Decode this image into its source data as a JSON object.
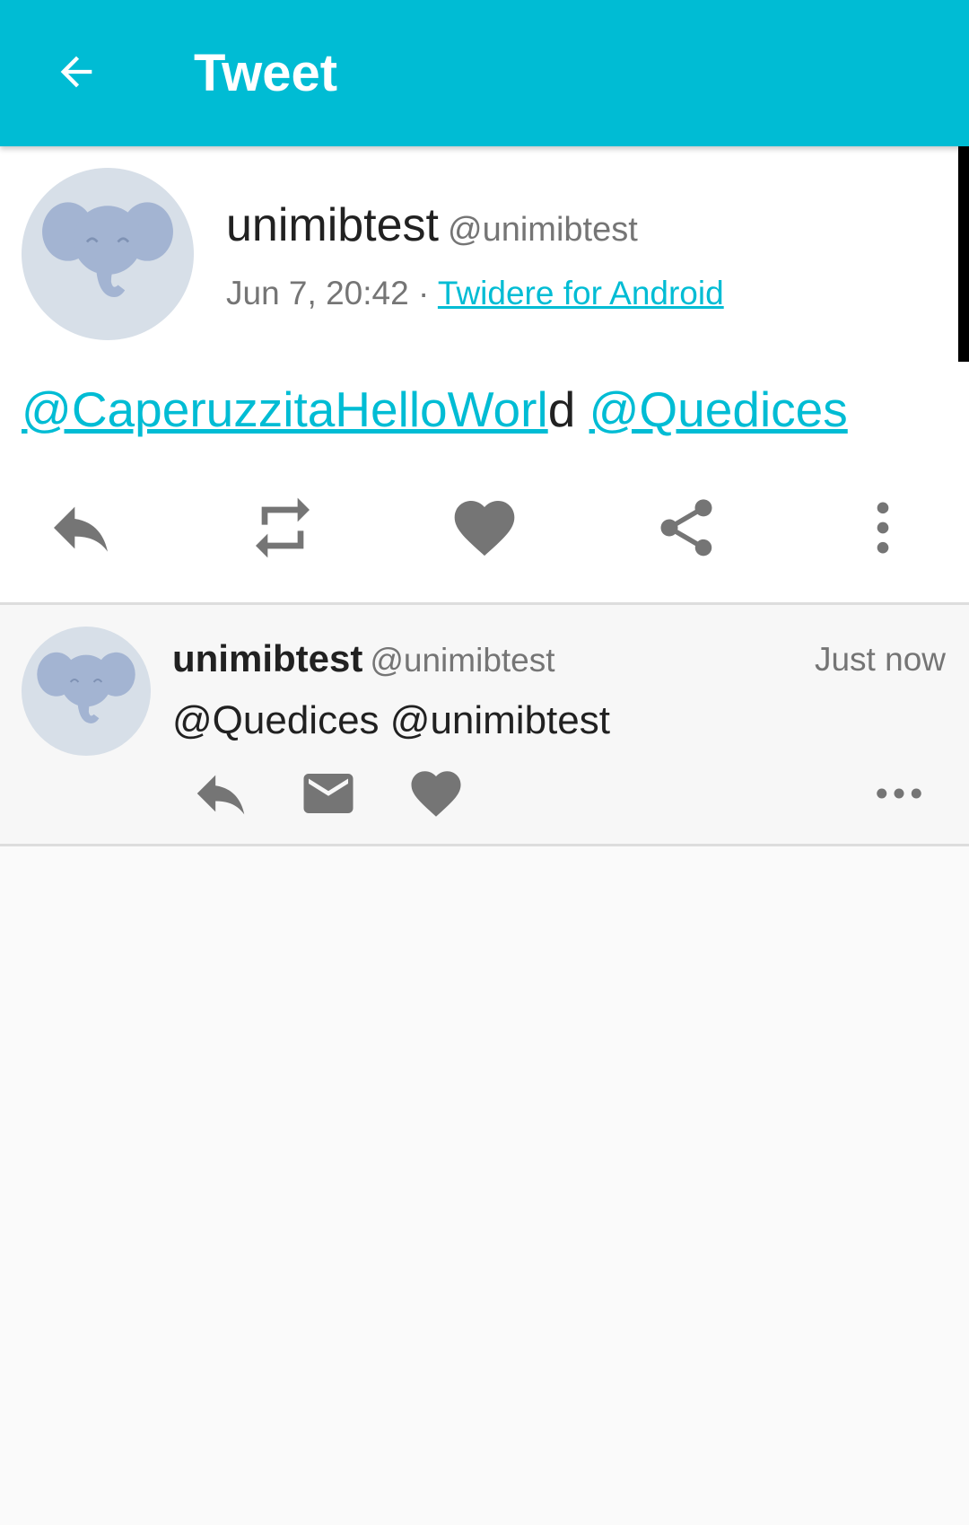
{
  "appbar": {
    "title": "Tweet",
    "color": "#00bcd4",
    "back_icon": "arrow-left-icon"
  },
  "main_tweet": {
    "display_name": "unimibtest",
    "handle": "@unimibtest",
    "time": "Jun 7, 20:42",
    "separator": " · ",
    "source": "Twidere for Android",
    "text_parts": {
      "mention1": "@CaperuzzitaHelloWorl",
      "plain": "d",
      "space": " ",
      "mention2": "@Quedices"
    },
    "actions": [
      "reply-icon",
      "retweet-icon",
      "heart-icon",
      "share-icon",
      "more-vertical-icon"
    ]
  },
  "reply_item": {
    "display_name": "unimibtest",
    "handle": "@unimibtest",
    "time": "Just now",
    "text": "@Quedices @unimibtest",
    "actions": [
      "reply-icon",
      "mail-icon",
      "heart-icon",
      "more-horizontal-icon"
    ]
  },
  "colors": {
    "accent": "#00bcd4",
    "icon_gray": "#757575",
    "text_primary": "#212121"
  }
}
